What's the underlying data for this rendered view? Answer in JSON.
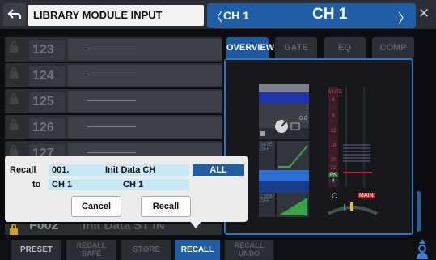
{
  "header": {
    "title": "LIBRARY MODULE INPUT",
    "channel_small": "CH 1",
    "channel_big": "CH 1",
    "prev_arrow": "〈",
    "next_arrow": "〉",
    "close": "✕"
  },
  "library": {
    "items": [
      {
        "number": "123",
        "name": ""
      },
      {
        "number": "124",
        "name": ""
      },
      {
        "number": "125",
        "name": ""
      },
      {
        "number": "126",
        "name": ""
      },
      {
        "number": "127",
        "name": ""
      }
    ],
    "partial_row": {
      "number": "F002",
      "name": "Init Data ST IN"
    }
  },
  "tabs": [
    {
      "label": "OVERVIEW",
      "active": true
    },
    {
      "label": "GATE",
      "active": false
    },
    {
      "label": "EQ",
      "active": false
    },
    {
      "label": "COMP",
      "active": false
    }
  ],
  "overview": {
    "gain_value": "0.0",
    "gate_label": "GATE\nOFF",
    "comp_label": "COMP\nOFF",
    "meter_labels": [
      "MUTE",
      "4",
      "8",
      "12",
      "16",
      "20",
      "22",
      "PK",
      "4"
    ],
    "pan": "C",
    "main_label": "MAIN"
  },
  "dialog": {
    "recall_label": "Recall",
    "recall_number": "001.",
    "recall_name": "Init Data CH",
    "all_label": "ALL",
    "to_label": "to",
    "to_channel": "CH 1",
    "to_name": "CH 1",
    "cancel_label": "Cancel",
    "recall_button_label": "Recall"
  },
  "bottom_bar": {
    "preset": "PRESET",
    "recall_safe": "RECALL\nSAFE",
    "store": "STORE",
    "recall": "RECALL",
    "recall_undo": "RECALL\nUNDO"
  },
  "colors": {
    "accent": "#1f5ea7",
    "dialog_field": "#c6e7f6",
    "lock_active": "#d4a01e",
    "panel_border": "#2c77c4"
  }
}
